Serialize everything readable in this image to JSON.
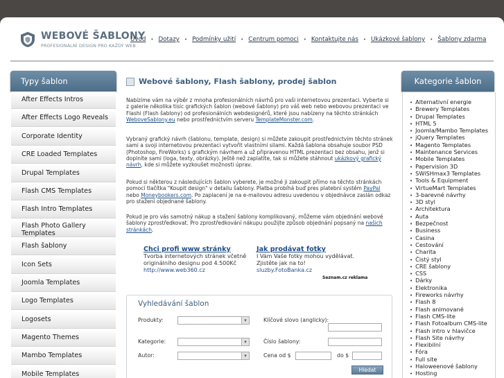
{
  "header": {
    "brand_title": "WEBOVÉ ŠABLONY",
    "brand_subtitle": "PROFESIONÁLNÍ DESIGN PRO KAŽDÝ WEB",
    "nav": [
      "Úvod",
      "Dotazy",
      "Podmínky užití",
      "Centrum pomoci",
      "Kontaktujte nás",
      "Ukázkové šablony",
      "Šablony zdarma"
    ],
    "nav_separator": "•"
  },
  "left_nav": {
    "title": "Typy šablon",
    "items": [
      "After Effects Intros",
      "After Effects Logo Reveals",
      "Corporate Identity",
      "CRE Loaded Templates",
      "Drupal Templates",
      "Flash CMS Templates",
      "Flash Intro Templates",
      "Flash Photo Gallery Templates",
      "Flash šablony",
      "Icon Sets",
      "Joomla Templates",
      "Logo Templates",
      "Logosets",
      "Magento Themes",
      "Mambo Templates",
      "Mobile Templates"
    ]
  },
  "right_nav": {
    "title": "Kategorie šablon",
    "items": [
      "Alternativní energie",
      "Brewery Templates",
      "Drupal Templates",
      "HTML 5",
      "Joomla/Mambo Templates",
      "jQuery Templates",
      "Magento Templates",
      "Maintenance Services",
      "Mobile Templates",
      "Papervision 3D",
      "SWiSHmax3 Templates",
      "Tools & Equipment",
      "VirtueMart Templates",
      "3-barevné návrhy",
      "3D styl",
      "Architektura",
      "Auta",
      "Bezpečnost",
      "Business",
      "Casina",
      "Cestování",
      "Charita",
      "Čistý styl",
      "CRE šablony",
      "CSS",
      "Dárky",
      "Elektronika",
      "Fireworks návrhy",
      "Flash 8",
      "Flash animované",
      "Flash CMS-lite",
      "Flash Fotoalbum CMS-lite",
      "Flash intro v hlavičce",
      "Flash Site návrhy",
      "Flexibilní",
      "Fóra",
      "Full site",
      "Haloweenové šablony",
      "Hosting"
    ]
  },
  "main": {
    "title": "Webové šablony, Flash šablony, prodej šablon",
    "p1_text": "Nabízíme vám na výběr z mnoha profesionálních návrhů pro vaši internetovou prezentaci. Vyberte si z galerie několika tisíc grafických šablon (webové šablony) pro váš web nebo webovou prezentaci ve Flashi (Flash šablony) od profesionálních webdesignérů, které jsou nabízeny na těchto stránkách ",
    "p1_link1": "WeboveSablony.eu",
    "p1_mid": " nebo prostřednictvím serveru ",
    "p1_link2": "TemplateMonster.com",
    "p1_end": ".",
    "p2_text": "Vybraný grafický návrh (šablonu, template, design) si můžete zakoupit prostřednictvím těchto stránek sami a svoji internetovou prezentaci vytvořit vlastními silami. Každá šablona obsahuje soubor PSD (Photoshop, FireWorks) s grafickým návrhem a už připravenou HTML prezentaci bez obsahu, jenž si doplníte sami (loga, texty, obrázky). Ještě než zaplatíte, tak si můžete stáhnout ",
    "p2_link": "ukázkový grafický návrh",
    "p2_end": ", kde si můžete vyzkoušet možnosti úprav.",
    "p3_text": "Pokud si některou z následujících šablon vyberete, je možné ji zakoupit přímo na těchto stránkách pomocí tlačítka \"Koupit design\" v detailu šablony. Platba probíhá buď pres platební systém ",
    "p3_link1": "PayPal",
    "p3_mid": " nebo ",
    "p3_link2": "Moneybookers.com",
    "p3_end": ". Po zaplacení je na e-mailovou adresu uvedenou v objednávce zaslán odkaz pro stažení objednané šablony.",
    "p4_text": "Pokud je pro vás samotný nákup a stažení šablony komplikovaný, můžeme vám objednání webové šablony zprostředkovat. Pro zprostředkování nákupu použijte způsob objednání popsaný na ",
    "p4_link": "našich stránkách",
    "p4_end": "."
  },
  "ads": [
    {
      "title": "Chci profi www stránky",
      "line1": "Tvorba internetových stránek včetně",
      "line2": "originálního designu pod 4.500Kč",
      "url": "http://www.web360.cz"
    },
    {
      "title": "Jak prodávat fotky",
      "line1": "I Vám Vaše fotky mohou vydělávat.",
      "line2": "Zjistěte jak na to!",
      "url": "sluzby.FotoBanka.cz"
    }
  ],
  "ads_footer": "Seznam.cz reklama",
  "search": {
    "title": "Vyhledávání šablon",
    "produkty_label": "Produkty:",
    "kategorie_label": "Kategorie:",
    "autor_label": "Autor:",
    "keyword_label": "Klíčové slovo (anglicky):",
    "number_label": "Číslo šablony:",
    "price_from_label": "Cena od $",
    "price_to_label": "do $",
    "button": "Hledat"
  },
  "colors": {
    "background": "#4a4744",
    "panel_header": "#5a7a94",
    "link": "#1f4f86",
    "title": "#3e5f7e"
  }
}
